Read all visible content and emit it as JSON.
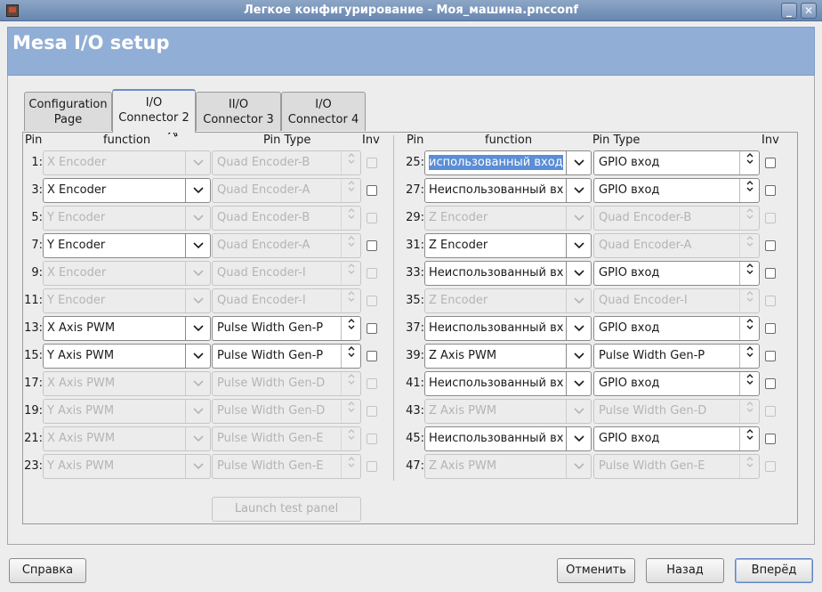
{
  "window": {
    "title": "Легкое конфигурирование - Моя_машина.pncconf",
    "minimize_glyph": "_",
    "close_glyph": "✕"
  },
  "header": {
    "title": "Mesa I/O setup"
  },
  "tabs": [
    {
      "line1": "Configuration",
      "line2": "Page"
    },
    {
      "line1": "I/O",
      "line2": "Connector 2"
    },
    {
      "line1": "II/O",
      "line2": "Connector 3"
    },
    {
      "line1": "I/O",
      "line2": "Connector 4"
    }
  ],
  "table_headers": {
    "pin": "Pin",
    "function": "function",
    "pin_type": "Pin Type",
    "inv": "Inv"
  },
  "left_rows": [
    {
      "pin": "1:",
      "function": "X Encoder",
      "pin_type": "Quad Encoder-B",
      "enabled": false
    },
    {
      "pin": "3:",
      "function": "X Encoder",
      "pin_type": "Quad Encoder-A",
      "enabled": true,
      "pt_enabled": false
    },
    {
      "pin": "5:",
      "function": "Y Encoder",
      "pin_type": "Quad Encoder-B",
      "enabled": false
    },
    {
      "pin": "7:",
      "function": "Y Encoder",
      "pin_type": "Quad Encoder-A",
      "enabled": true,
      "pt_enabled": false
    },
    {
      "pin": "9:",
      "function": "X Encoder",
      "pin_type": "Quad Encoder-I",
      "enabled": false
    },
    {
      "pin": "11:",
      "function": "Y Encoder",
      "pin_type": "Quad Encoder-I",
      "enabled": false
    },
    {
      "pin": "13:",
      "function": "X Axis PWM",
      "pin_type": "Pulse Width Gen-P",
      "enabled": true,
      "pt_enabled": true
    },
    {
      "pin": "15:",
      "function": "Y Axis PWM",
      "pin_type": "Pulse Width Gen-P",
      "enabled": true,
      "pt_enabled": true
    },
    {
      "pin": "17:",
      "function": "X Axis PWM",
      "pin_type": "Pulse Width Gen-D",
      "enabled": false
    },
    {
      "pin": "19:",
      "function": "Y Axis PWM",
      "pin_type": "Pulse Width Gen-D",
      "enabled": false
    },
    {
      "pin": "21:",
      "function": "X Axis PWM",
      "pin_type": "Pulse Width Gen-E",
      "enabled": false
    },
    {
      "pin": "23:",
      "function": "Y Axis PWM",
      "pin_type": "Pulse Width Gen-E",
      "enabled": false
    }
  ],
  "right_rows": [
    {
      "pin": "25:",
      "function": "использованный вход",
      "pin_type": "GPIO вход",
      "enabled": true,
      "pt_enabled": true,
      "selected": true
    },
    {
      "pin": "27:",
      "function": "Неиспользованный вх",
      "pin_type": "GPIO вход",
      "enabled": true,
      "pt_enabled": true
    },
    {
      "pin": "29:",
      "function": "Z Encoder",
      "pin_type": "Quad Encoder-B",
      "enabled": false
    },
    {
      "pin": "31:",
      "function": "Z Encoder",
      "pin_type": "Quad Encoder-A",
      "enabled": true,
      "pt_enabled": false
    },
    {
      "pin": "33:",
      "function": "Неиспользованный вх",
      "pin_type": "GPIO вход",
      "enabled": true,
      "pt_enabled": true
    },
    {
      "pin": "35:",
      "function": "Z Encoder",
      "pin_type": "Quad Encoder-I",
      "enabled": false
    },
    {
      "pin": "37:",
      "function": "Неиспользованный вх",
      "pin_type": "GPIO вход",
      "enabled": true,
      "pt_enabled": true
    },
    {
      "pin": "39:",
      "function": "Z Axis PWM",
      "pin_type": "Pulse Width Gen-P",
      "enabled": true,
      "pt_enabled": true
    },
    {
      "pin": "41:",
      "function": "Неиспользованный вх",
      "pin_type": "GPIO вход",
      "enabled": true,
      "pt_enabled": true
    },
    {
      "pin": "43:",
      "function": "Z Axis PWM",
      "pin_type": "Pulse Width Gen-D",
      "enabled": false
    },
    {
      "pin": "45:",
      "function": "Неиспользованный вх",
      "pin_type": "GPIO вход",
      "enabled": true,
      "pt_enabled": true
    },
    {
      "pin": "47:",
      "function": "Z Axis PWM",
      "pin_type": "Pulse Width Gen-E",
      "enabled": false
    }
  ],
  "launch_test_panel": "Launch test panel",
  "buttons": {
    "help": "Справка",
    "cancel": "Отменить",
    "back": "Назад",
    "forward": "Вперёд"
  },
  "icons": {
    "combo_arrow": "chevron-down-icon",
    "spin": "updown-icon",
    "cursor": "mouse-pointer-icon"
  },
  "colors": {
    "titlebar": "#7791b8",
    "header": "#91aed6",
    "selection": "#5b8ed6",
    "active_tab_accent": "#6a8ccb"
  }
}
